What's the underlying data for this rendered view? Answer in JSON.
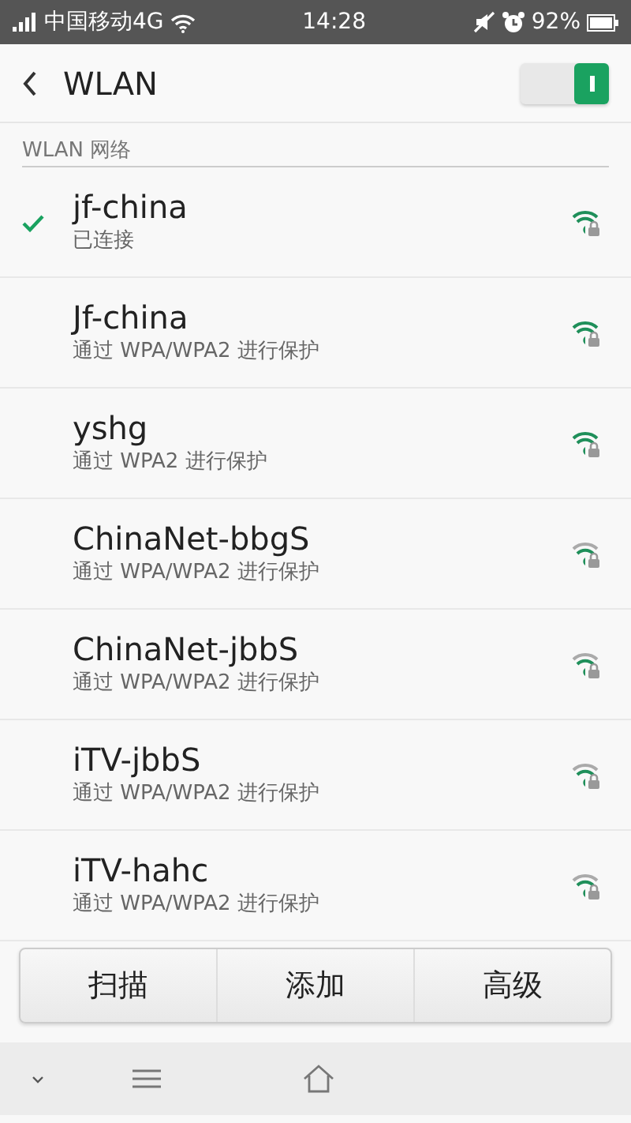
{
  "status_bar": {
    "carrier": "中国移动4G",
    "time": "14:28",
    "battery": "92%"
  },
  "header": {
    "title": "WLAN",
    "wlan_on": true
  },
  "section": {
    "title": "WLAN 网络"
  },
  "networks": [
    {
      "name": "jf-china",
      "subtitle": "已连接",
      "connected": true,
      "signal_full": true
    },
    {
      "name": "Jf-china",
      "subtitle": "通过 WPA/WPA2 进行保护",
      "connected": false,
      "signal_full": true
    },
    {
      "name": "yshg",
      "subtitle": "通过 WPA2 进行保护",
      "connected": false,
      "signal_full": true
    },
    {
      "name": "ChinaNet-bbgS",
      "subtitle": "通过 WPA/WPA2 进行保护",
      "connected": false,
      "signal_full": false
    },
    {
      "name": "ChinaNet-jbbS",
      "subtitle": "通过 WPA/WPA2 进行保护",
      "connected": false,
      "signal_full": false
    },
    {
      "name": "iTV-jbbS",
      "subtitle": "通过 WPA/WPA2 进行保护",
      "connected": false,
      "signal_full": false
    },
    {
      "name": "iTV-hahc",
      "subtitle": "通过 WPA/WPA2 进行保护",
      "connected": false,
      "signal_full": false
    }
  ],
  "buttons": [
    "扫描",
    "添加",
    "高级"
  ]
}
